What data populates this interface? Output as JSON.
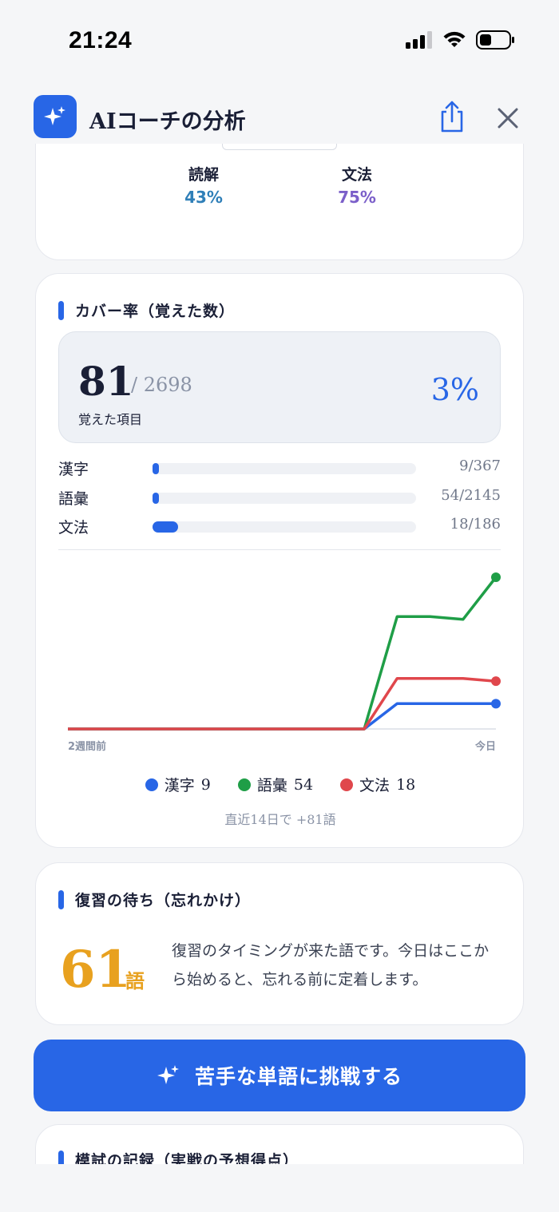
{
  "status": {
    "time": "21:24"
  },
  "header": {
    "title": "AIコーチの分析"
  },
  "skills": [
    {
      "label": "読解",
      "value": "43%",
      "color": "#2f7fb8"
    },
    {
      "label": "文法",
      "value": "75%",
      "color": "#7b5fc9"
    }
  ],
  "coverage": {
    "title": "カバー率（覚えた数）",
    "learned": "81",
    "total": "/ 2698",
    "learned_label": "覚えた項目",
    "percent": "3%",
    "rows": [
      {
        "name": "漢字",
        "count": "9/367",
        "fraction": 0.0245
      },
      {
        "name": "語彙",
        "count": "54/2145",
        "fraction": 0.0252
      },
      {
        "name": "文法",
        "count": "18/186",
        "fraction": 0.0968
      }
    ],
    "legend": [
      {
        "label": "漢字",
        "value": "9",
        "color": "#2866e6"
      },
      {
        "label": "語彙",
        "value": "54",
        "color": "#1f9e47"
      },
      {
        "label": "文法",
        "value": "18",
        "color": "#e0474c"
      }
    ],
    "delta": "直近14日で +81語"
  },
  "chart_data": {
    "type": "line",
    "x": [
      1,
      2,
      3,
      4,
      5,
      6,
      7,
      8,
      9,
      10,
      11,
      12,
      13,
      14
    ],
    "x_tick_labels": [
      "2週間前",
      "今日"
    ],
    "series": [
      {
        "name": "漢字",
        "color": "#2866e6",
        "values": [
          0,
          0,
          0,
          0,
          0,
          0,
          0,
          0,
          0,
          0,
          9,
          9,
          9,
          9
        ]
      },
      {
        "name": "語彙",
        "color": "#1f9e47",
        "values": [
          0,
          0,
          0,
          0,
          0,
          0,
          0,
          0,
          0,
          0,
          40,
          40,
          39,
          54
        ]
      },
      {
        "name": "文法",
        "color": "#e0474c",
        "values": [
          0,
          0,
          0,
          0,
          0,
          0,
          0,
          0,
          0,
          0,
          18,
          18,
          18,
          17
        ]
      }
    ],
    "ylim": [
      0,
      54
    ],
    "grid": false
  },
  "review": {
    "title": "復習の待ち（忘れかけ）",
    "count": "61",
    "unit": "語",
    "text": "復習のタイミングが来た語です。今日はここから始めると、忘れる前に定着します。"
  },
  "cta": {
    "label": "苦手な単語に挑戦する"
  },
  "mock": {
    "title": "模試の記録（実戦の予想得点）"
  }
}
